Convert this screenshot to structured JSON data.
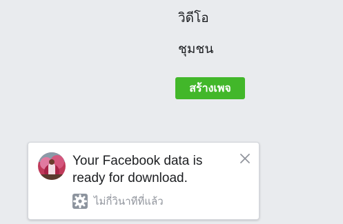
{
  "menu": {
    "video_label": "วิดีโอ",
    "community_label": "ชุมชน",
    "create_page_label": "สร้างเพจ"
  },
  "notification": {
    "message": "Your Facebook data is ready for download.",
    "time": "ไม่กี่วินาทีที่แล้ว",
    "settings_icon": "gear-icon",
    "close_icon": "close-icon"
  },
  "colors": {
    "background": "#e9ebee",
    "create_button": "#42b72a",
    "meta_text": "#90949c"
  }
}
